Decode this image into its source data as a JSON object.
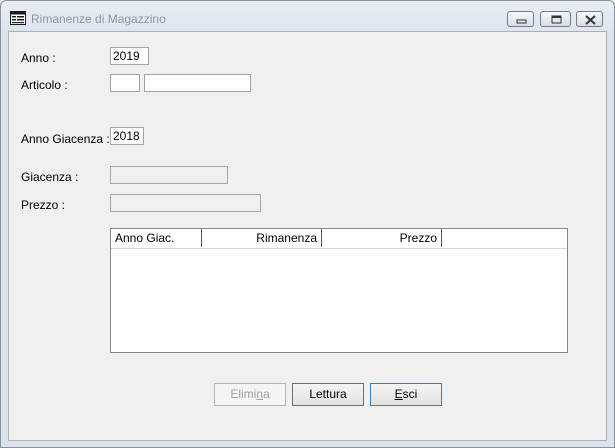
{
  "window": {
    "title": "Rimanenze di Magazzino",
    "icons": {
      "app": "form-window-icon",
      "minimize": "minimize-icon",
      "maximize": "maximize-icon",
      "close": "close-icon"
    }
  },
  "form": {
    "anno_label": "Anno  :",
    "anno_value": "2019",
    "articolo_label": "Articolo :",
    "articolo_code": "",
    "articolo_desc": "",
    "anno_giacenza_label": "Anno Giacenza :",
    "anno_giacenza_value": "2018",
    "giacenza_label": "Giacenza :",
    "giacenza_value": "",
    "prezzo_label": "Prezzo :",
    "prezzo_value": ""
  },
  "list": {
    "columns": [
      "Anno Giac.",
      "Rimanenza",
      "Prezzo"
    ],
    "rows": []
  },
  "buttons": {
    "elimina": {
      "before": "Elimi",
      "access": "n",
      "after": "a"
    },
    "lettura": {
      "label": "Lettura"
    },
    "esci": {
      "before": "",
      "access": "E",
      "after": "sci"
    }
  }
}
